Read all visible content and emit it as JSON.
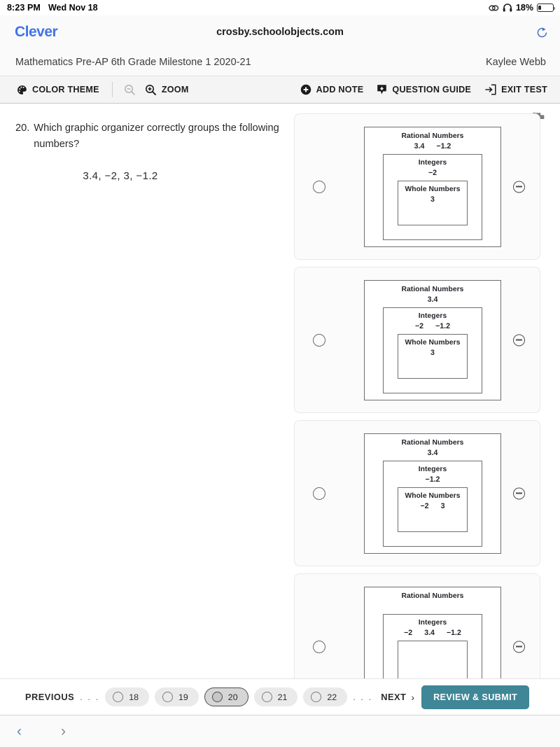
{
  "status_bar": {
    "time": "8:23 PM",
    "date": "Wed Nov 18",
    "battery_percent": "18%",
    "icons": [
      "screen-mirroring-icon",
      "headphones-icon",
      "battery-icon"
    ]
  },
  "browser": {
    "brand": "Clever",
    "url": "crosby.schoolobjects.com",
    "reload_icon": "reload-icon",
    "back_icon": "chevron-left-icon",
    "forward_icon": "chevron-right-icon"
  },
  "test_header": {
    "title": "Mathematics Pre-AP 6th Grade Milestone 1 2020-21",
    "student": "Kaylee Webb"
  },
  "toolbar": {
    "color_theme": "COLOR THEME",
    "zoom": "ZOOM",
    "add_note": "ADD NOTE",
    "question_guide": "QUESTION GUIDE",
    "exit_test": "EXIT TEST",
    "icons": {
      "palette": "palette-icon",
      "zoom_out": "zoom-out-icon",
      "zoom_in": "zoom-in-icon",
      "add_note": "plus-circle-icon",
      "question_guide": "question-guide-icon",
      "exit_test": "exit-arrow-icon",
      "flag": "flag-icon"
    }
  },
  "question": {
    "number": "20.",
    "prompt": "Which graphic organizer correctly groups the following numbers?",
    "numbers": "3.4,  −2,  3,  −1.2"
  },
  "options": [
    {
      "id": "option-a",
      "selected": false,
      "levels": [
        {
          "title": "Rational Numbers",
          "values": [
            "3.4",
            "−1.2"
          ]
        },
        {
          "title": "Integers",
          "values": [
            "−2"
          ]
        },
        {
          "title": "Whole Numbers",
          "values": [
            "3"
          ]
        }
      ]
    },
    {
      "id": "option-b",
      "selected": false,
      "levels": [
        {
          "title": "Rational Numbers",
          "values": [
            "3.4"
          ]
        },
        {
          "title": "Integers",
          "values": [
            "−2",
            "−1.2"
          ]
        },
        {
          "title": "Whole Numbers",
          "values": [
            "3"
          ]
        }
      ]
    },
    {
      "id": "option-c",
      "selected": false,
      "levels": [
        {
          "title": "Rational Numbers",
          "values": [
            "3.4"
          ]
        },
        {
          "title": "Integers",
          "values": [
            "−1.2"
          ]
        },
        {
          "title": "Whole Numbers",
          "values": [
            "−2",
            "3"
          ]
        }
      ]
    },
    {
      "id": "option-d",
      "selected": false,
      "levels": [
        {
          "title": "Rational Numbers",
          "values": []
        },
        {
          "title": "Integers",
          "values": [
            "−2",
            "3.4",
            "−1.2"
          ]
        },
        {
          "title": "",
          "values": []
        }
      ]
    }
  ],
  "bottom_nav": {
    "previous": "PREVIOUS",
    "next": "NEXT",
    "ellipsis_left": ". . .",
    "ellipsis_right": ". . .",
    "submit": "REVIEW & SUBMIT",
    "submit_color": "#3f8696",
    "pages": [
      {
        "label": "18",
        "current": false
      },
      {
        "label": "19",
        "current": false
      },
      {
        "label": "20",
        "current": true
      },
      {
        "label": "21",
        "current": false
      },
      {
        "label": "22",
        "current": false
      }
    ]
  }
}
